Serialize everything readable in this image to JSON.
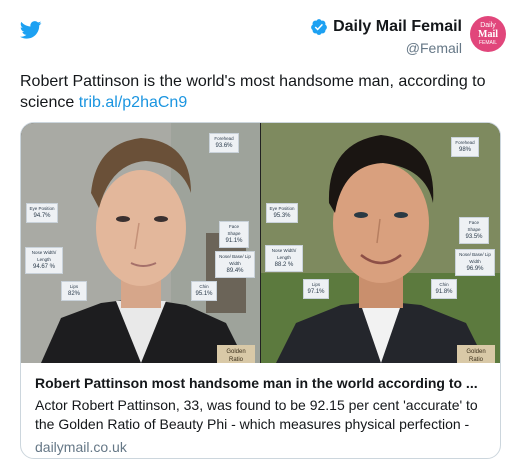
{
  "tweet": {
    "text": "Robert Pattinson is the world's most handsome man, according to science ",
    "link": "trib.al/p2haCn9"
  },
  "author": {
    "display_name": "Daily Mail Femail",
    "handle": "@Femail",
    "verified_icon": "verified-badge-icon",
    "avatar_text": {
      "line1": "Daily",
      "line2": "Mail",
      "line3": "FEMAIL"
    }
  },
  "brand": {
    "icon": "twitter-bird-icon",
    "color": "#1da1f2"
  },
  "card": {
    "title": "Robert Pattinson most handsome man in the world according to ...",
    "description": "Actor Robert Pattinson, 33, was found to be 92.15 per cent 'accurate' to the Golden Ratio of Beauty Phi - which measures physical perfection -",
    "domain": "dailymail.co.uk",
    "left_photo": {
      "labels": [
        {
          "key": "forehead",
          "title": "Forehead",
          "value": "93.6%"
        },
        {
          "key": "eye_position",
          "title": "Eye Position",
          "value": "94.7%"
        },
        {
          "key": "face_shape",
          "title": "Face Shape",
          "value": "91.1%"
        },
        {
          "key": "nose_width",
          "title": "Nose Width/ Length",
          "value": "94.67 %"
        },
        {
          "key": "nose_lip",
          "title": "Nose/ Base/ Lip Width",
          "value": "89.4%"
        },
        {
          "key": "lips",
          "title": "Lips",
          "value": "82%"
        },
        {
          "key": "chin",
          "title": "Chin",
          "value": "95.1%"
        }
      ],
      "golden_ratio_label": "Golden Ratio Rating"
    },
    "right_photo": {
      "labels": [
        {
          "key": "forehead",
          "title": "Forehead",
          "value": "98%"
        },
        {
          "key": "eye_position",
          "title": "Eye Position",
          "value": "95.3%"
        },
        {
          "key": "face_shape",
          "title": "Face Shape",
          "value": "93.5%"
        },
        {
          "key": "nose_width",
          "title": "Nose Width/ Length",
          "value": "88.2 %"
        },
        {
          "key": "nose_lip",
          "title": "Nose/ Base/ Lip Width",
          "value": "96.9%"
        },
        {
          "key": "lips",
          "title": "Lips",
          "value": "97.1%"
        },
        {
          "key": "chin",
          "title": "Chin",
          "value": "91.8%"
        }
      ],
      "golden_ratio_label": "Golden Ratio Rating"
    }
  }
}
